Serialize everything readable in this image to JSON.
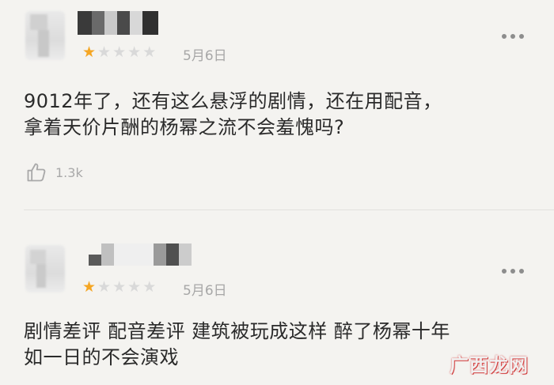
{
  "reviews": [
    {
      "rating": 1,
      "max_rating": 5,
      "date": "5月6日",
      "text_line1": "9012年了，还有这么悬浮的剧情，还在用配音，",
      "text_line2": "拿着天价片酬的杨幂之流不会羞愧吗?",
      "likes": "1.3k"
    },
    {
      "rating": 1,
      "max_rating": 5,
      "date": "5月6日",
      "text_line1": "剧情差评 配音差评 建筑被玩成这样 醉了杨幂十年",
      "text_line2": "如一日的不会演戏"
    }
  ],
  "watermark": "广西龙网",
  "colors": {
    "star_on": "#f5a623",
    "star_off": "#d9d9d9",
    "background": "#f4f3f0"
  },
  "icons": [
    "more-options-icon",
    "thumbs-up-icon",
    "star-icon"
  ]
}
